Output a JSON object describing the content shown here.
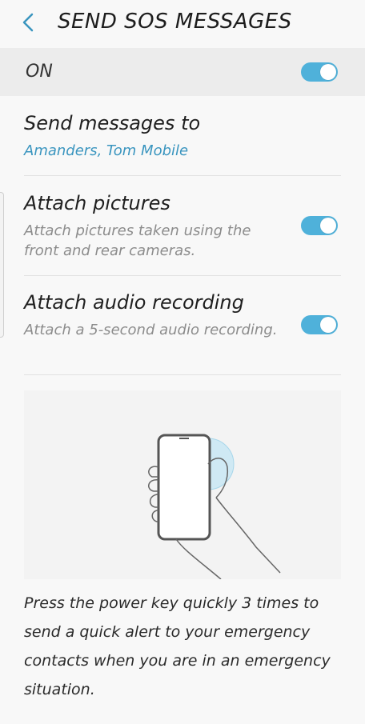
{
  "header": {
    "title": "SEND SOS MESSAGES",
    "back_icon": "chevron-left-icon"
  },
  "master": {
    "label": "ON",
    "enabled": true
  },
  "settings": [
    {
      "title": "Send messages to",
      "subtitle": "Amanders, Tom Mobile"
    },
    {
      "title": "Attach pictures",
      "subtitle": "Attach pictures taken using the front and rear cameras.",
      "enabled": true
    },
    {
      "title": "Attach audio recording",
      "subtitle": "Attach a 5-second audio recording.",
      "enabled": true
    }
  ],
  "illustration": {
    "icon": "hand-pressing-power-key-illustration"
  },
  "description": "Press the power key quickly 3 times to send a quick alert to your emergency contacts when you are in an emergency situation.",
  "colors": {
    "accent": "#4fb1da",
    "link": "#3a95bf",
    "background": "#f8f8f8"
  }
}
